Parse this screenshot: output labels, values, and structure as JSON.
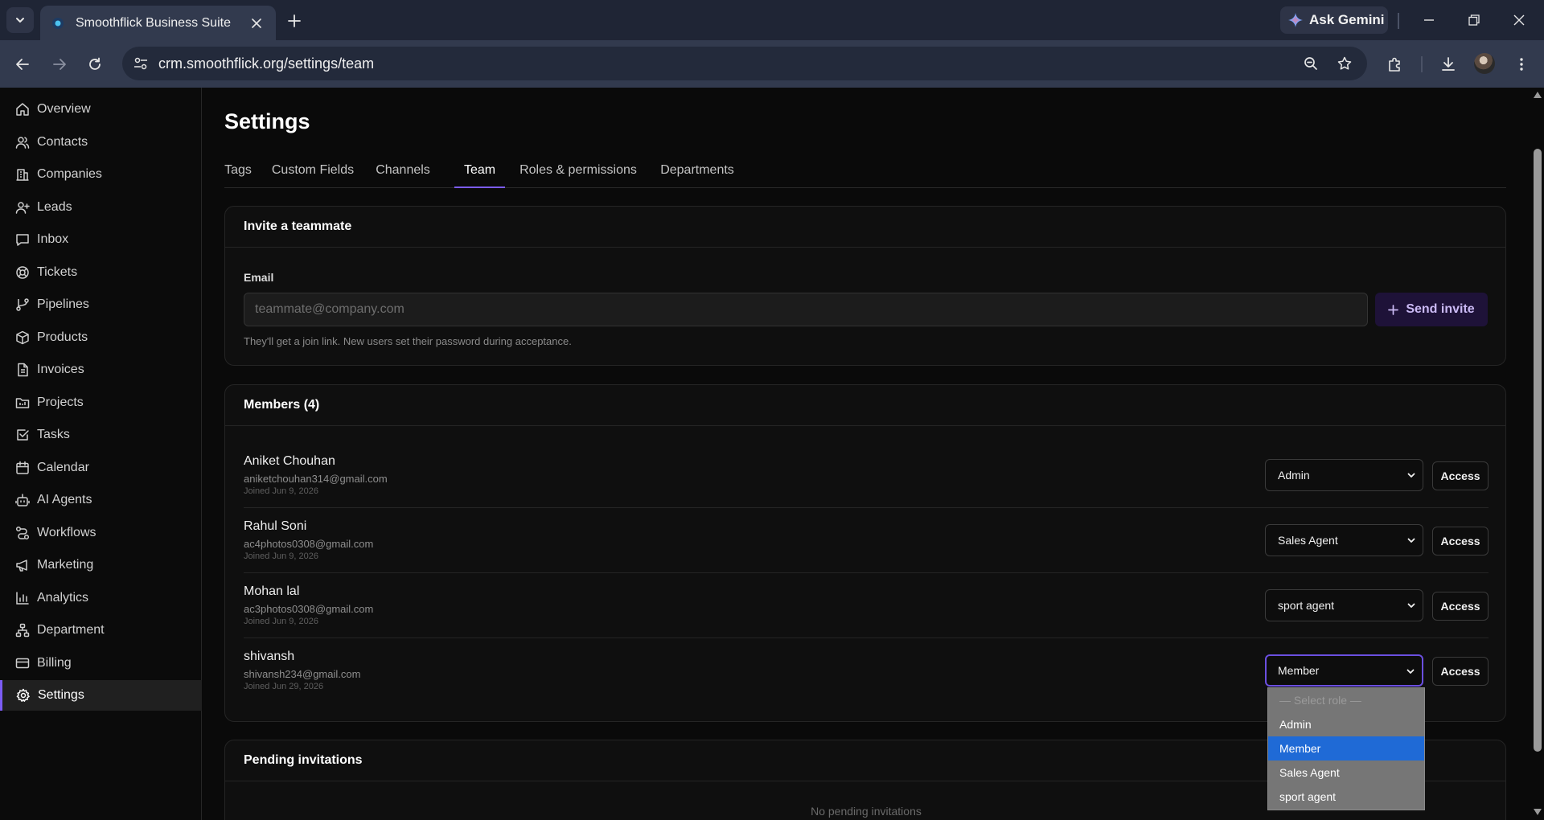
{
  "browser": {
    "tab_title": "Smoothflick Business Suite",
    "url": "crm.smoothflick.org/settings/team",
    "gemini_label": "Ask Gemini"
  },
  "sidebar": {
    "items": [
      {
        "label": "Overview",
        "icon": "home-icon"
      },
      {
        "label": "Contacts",
        "icon": "users-icon"
      },
      {
        "label": "Companies",
        "icon": "building-icon"
      },
      {
        "label": "Leads",
        "icon": "user-plus-icon"
      },
      {
        "label": "Inbox",
        "icon": "message-icon"
      },
      {
        "label": "Tickets",
        "icon": "lifebuoy-icon"
      },
      {
        "label": "Pipelines",
        "icon": "git-branch-icon"
      },
      {
        "label": "Products",
        "icon": "package-icon"
      },
      {
        "label": "Invoices",
        "icon": "file-text-icon"
      },
      {
        "label": "Projects",
        "icon": "folder-icon"
      },
      {
        "label": "Tasks",
        "icon": "check-square-icon"
      },
      {
        "label": "Calendar",
        "icon": "calendar-icon"
      },
      {
        "label": "AI Agents",
        "icon": "bot-icon"
      },
      {
        "label": "Workflows",
        "icon": "workflow-icon"
      },
      {
        "label": "Marketing",
        "icon": "megaphone-icon"
      },
      {
        "label": "Analytics",
        "icon": "bar-chart-icon"
      },
      {
        "label": "Department",
        "icon": "network-icon"
      },
      {
        "label": "Billing",
        "icon": "credit-card-icon"
      },
      {
        "label": "Settings",
        "icon": "gear-icon",
        "active": true
      }
    ]
  },
  "page": {
    "title": "Settings",
    "tabs": [
      "Tags",
      "Custom Fields",
      "Channels",
      "Team",
      "Roles & permissions",
      "Departments"
    ],
    "active_tab": "Team"
  },
  "invite": {
    "heading": "Invite a teammate",
    "email_label": "Email",
    "email_placeholder": "teammate@company.com",
    "email_value": "",
    "button_label": "Send invite",
    "hint": "They'll get a join link. New users set their password during acceptance."
  },
  "members": {
    "heading": "Members (4)",
    "access_label": "Access",
    "rows": [
      {
        "name": "Aniket Chouhan",
        "email": "aniketchouhan314@gmail.com",
        "joined": "Joined Jun 9, 2026",
        "role": "Admin"
      },
      {
        "name": "Rahul Soni",
        "email": "ac4photos0308@gmail.com",
        "joined": "Joined Jun 9, 2026",
        "role": "Sales Agent"
      },
      {
        "name": "Mohan lal",
        "email": "ac3photos0308@gmail.com",
        "joined": "Joined Jun 9, 2026",
        "role": "sport agent"
      },
      {
        "name": "shivansh",
        "email": "shivansh234@gmail.com",
        "joined": "Joined Jun 29, 2026",
        "role": "Member"
      }
    ]
  },
  "role_dropdown": {
    "options": [
      "— Select role —",
      "Admin",
      "Member",
      "Sales Agent",
      "sport agent"
    ],
    "selected": "Member"
  },
  "pending": {
    "heading": "Pending invitations",
    "empty_text": "No pending invitations"
  },
  "colors": {
    "accent": "#7c5cf5",
    "dropdown_selected": "#1f6ad6"
  }
}
